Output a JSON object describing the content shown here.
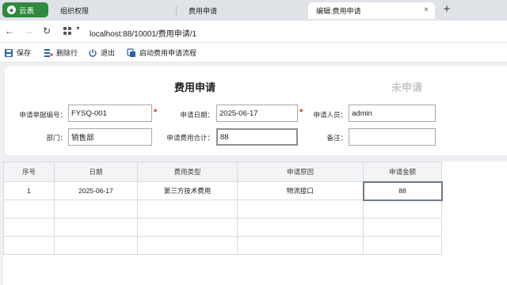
{
  "browser": {
    "app_tab_label": "云表",
    "tabs": [
      {
        "label": "组织权限"
      },
      {
        "label": "费用申请"
      },
      {
        "label": "编辑:费用申请",
        "close": "×"
      }
    ],
    "new_tab": "+",
    "url": "localhost:88/10001/费用申请/1"
  },
  "toolbar": {
    "save": "保存",
    "delete_row": "删除行",
    "exit": "退出",
    "start_flow": "启动费用申请流程"
  },
  "form": {
    "title": "费用申请",
    "status": "未申请",
    "fields": {
      "doc_no_label": "申请单据编号：",
      "doc_no": "FYSQ-001",
      "date_label": "申请日期：",
      "date": "2025-06-17",
      "applicant_label": "申请人员：",
      "applicant": "admin",
      "dept_label": "部门：",
      "dept": "销售部",
      "total_label": "申请费用合计：",
      "total": "88",
      "remark_label": "备注：",
      "remark": ""
    },
    "required_mark": "*"
  },
  "table": {
    "headers": [
      "序号",
      "日期",
      "费用类型",
      "申请原因",
      "申请金额"
    ],
    "rows": [
      [
        "1",
        "2025-06-17",
        "第三方技术费用",
        "物流接口",
        "88"
      ],
      [
        "",
        "",
        "",
        "",
        ""
      ],
      [
        "",
        "",
        "",
        "",
        ""
      ],
      [
        "",
        "",
        "",
        "",
        ""
      ]
    ]
  },
  "colors": {
    "brand": "#2e8b3e",
    "required": "#d9262c",
    "toolbar_icon": "#2b5fb4"
  }
}
